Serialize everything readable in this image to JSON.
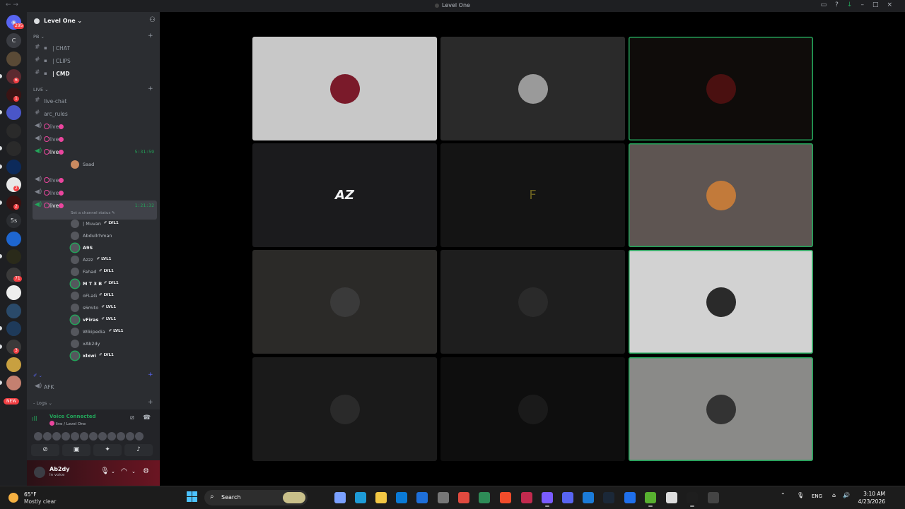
{
  "window": {
    "title": "Level One",
    "nav": "← →"
  },
  "rail": {
    "dm_badge": "295",
    "servers": [
      {
        "label": "C",
        "badge": ""
      },
      {
        "label": "",
        "badge": ""
      },
      {
        "label": "",
        "badge": "6"
      },
      {
        "label": "",
        "badge": "1"
      },
      {
        "label": "",
        "badge": ""
      },
      {
        "label": "",
        "badge": ""
      },
      {
        "label": "",
        "badge": ""
      },
      {
        "label": "",
        "badge": ""
      },
      {
        "label": "",
        "badge": "2"
      },
      {
        "label": "",
        "badge": "2"
      },
      {
        "label": "5s",
        "badge": ""
      },
      {
        "label": "",
        "badge": ""
      },
      {
        "label": "",
        "badge": ""
      },
      {
        "label": "",
        "badge": "71"
      },
      {
        "label": "",
        "badge": ""
      },
      {
        "label": "",
        "badge": ""
      },
      {
        "label": "",
        "badge": ""
      },
      {
        "label": "",
        "badge": "3"
      },
      {
        "label": "",
        "badge": ""
      },
      {
        "label": "",
        "badge": ""
      }
    ],
    "new_label": "NEW"
  },
  "guild": {
    "name": "Level One"
  },
  "categories": {
    "pb": "PB",
    "live": "LIVE",
    "unnamed": "",
    "logs": "- Logs"
  },
  "text_channels_pb": [
    {
      "name": "| CHAT",
      "bold": false
    },
    {
      "name": "| CLIPS",
      "bold": false
    },
    {
      "name": "| CMD",
      "bold": true
    }
  ],
  "live_channels": [
    {
      "name": "live-chat",
      "type": "text"
    },
    {
      "name": "arc_rules",
      "type": "text"
    }
  ],
  "voice_channels": [
    {
      "name": "live",
      "timer": ""
    },
    {
      "name": "live",
      "timer": ""
    },
    {
      "name": "live",
      "timer": "5:31:59"
    },
    {
      "name": "live",
      "timer": ""
    },
    {
      "name": "live",
      "timer": ""
    },
    {
      "name": "live",
      "timer": "1:21:32"
    }
  ],
  "saad": "Saad",
  "channel_status": "Set a channel status",
  "members": [
    {
      "name": "| Muvan",
      "tag": "LVL1",
      "bold": false
    },
    {
      "name": "Abdullrhman",
      "tag": "",
      "bold": false
    },
    {
      "name": "A9S",
      "tag": "",
      "bold": true
    },
    {
      "name": "Azzz",
      "tag": "LVL1",
      "bold": false
    },
    {
      "name": "Fahad",
      "tag": "LVL1",
      "bold": false
    },
    {
      "name": "M T 3 B",
      "tag": "LVL1",
      "bold": true
    },
    {
      "name": "oFLaG",
      "tag": "LVL1",
      "bold": false
    },
    {
      "name": "s6mito",
      "tag": "LVL1",
      "bold": false
    },
    {
      "name": "vFiras",
      "tag": "LVL1",
      "bold": true
    },
    {
      "name": "Wikipedia",
      "tag": "LVL1",
      "bold": false
    },
    {
      "name": "xAb2dy",
      "tag": "",
      "bold": false
    },
    {
      "name": "xlxwi",
      "tag": "LVL1",
      "bold": true
    }
  ],
  "afk": "AFK",
  "voice_panel": {
    "status": "Voice Connected",
    "channel": "live / Level One"
  },
  "user": {
    "name": "Ab2dy",
    "status": "In voice"
  },
  "tiles": [
    {
      "bg": "#c8c8c8",
      "pic": "#7a1a2a",
      "speaking": false
    },
    {
      "bg": "#2a2a2a",
      "pic": "#9a9a9a",
      "speaking": false
    },
    {
      "bg": "#0f0c0a",
      "pic": "#4a1010",
      "speaking": true
    },
    {
      "bg": "#1b1b1d",
      "pic": "#1b1b1d",
      "speaking": false
    },
    {
      "bg": "#141414",
      "pic": "#141414",
      "speaking": false
    },
    {
      "bg": "#5e5552",
      "pic": "#c27a3a",
      "speaking": true
    },
    {
      "bg": "#2b2a28",
      "pic": "#3a3a3a",
      "speaking": false
    },
    {
      "bg": "#1e1e1e",
      "pic": "#2a2a2a",
      "speaking": false
    },
    {
      "bg": "#d2d2d2",
      "pic": "#2a2a2a",
      "speaking": true
    },
    {
      "bg": "#1a1a1a",
      "pic": "#2a2a2a",
      "speaking": false
    },
    {
      "bg": "#0e0e0e",
      "pic": "#1a1a1a",
      "speaking": false
    },
    {
      "bg": "#8a8a88",
      "pic": "#333333",
      "speaking": true
    }
  ],
  "tile_labels": {
    "az": "AZ"
  },
  "taskbar": {
    "temp": "65°F",
    "weather": "Mostly clear",
    "search": "Search",
    "lang": "ENG",
    "time": "3:10 AM",
    "date": "4/23/2026",
    "app_colors": [
      "#e6e6e6",
      "#7aa0ff",
      "#1e9bd7",
      "#f2c744",
      "#0a7ad6",
      "#1e6fd9",
      "#777",
      "#e04a3f",
      "#2e8b57",
      "#f14c2b",
      "#c22a4e",
      "#7a5cff",
      "#5865f2",
      "#1b7bd8",
      "#1b2838",
      "#1f6feb",
      "#58b030",
      "#dcdcdc",
      "#1e1e1e",
      "#444"
    ]
  }
}
